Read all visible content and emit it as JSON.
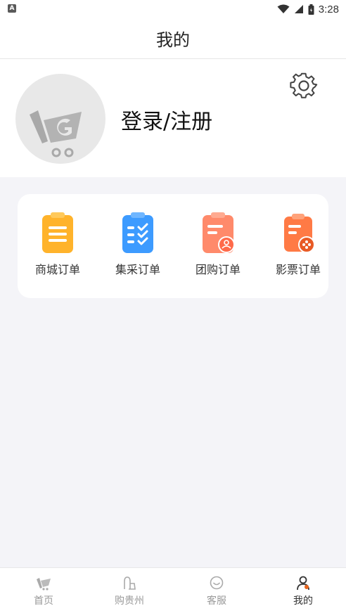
{
  "status_bar": {
    "app_badge": "A",
    "time": "3:28"
  },
  "header": {
    "title": "我的"
  },
  "profile": {
    "login_label": "登录/注册"
  },
  "orders": [
    {
      "label": "商城订单",
      "icon": "mall-order-icon",
      "color": "#FFB32B"
    },
    {
      "label": "集采订单",
      "icon": "group-purchase-order-icon",
      "color": "#3D9BFF"
    },
    {
      "label": "团购订单",
      "icon": "team-buy-order-icon",
      "color": "#FF8A6B"
    },
    {
      "label": "影票订单",
      "icon": "movie-ticket-order-icon",
      "color": "#FF7A45"
    }
  ],
  "tabbar": [
    {
      "label": "首页",
      "icon": "home-logo-icon",
      "active": false
    },
    {
      "label": "购贵州",
      "icon": "shopping-bag-icon",
      "active": false
    },
    {
      "label": "客服",
      "icon": "customer-service-icon",
      "active": false
    },
    {
      "label": "我的",
      "icon": "user-icon",
      "active": true
    }
  ],
  "colors": {
    "accent": "#E8641C",
    "background": "#F4F4F8",
    "tab_inactive": "#999999"
  }
}
